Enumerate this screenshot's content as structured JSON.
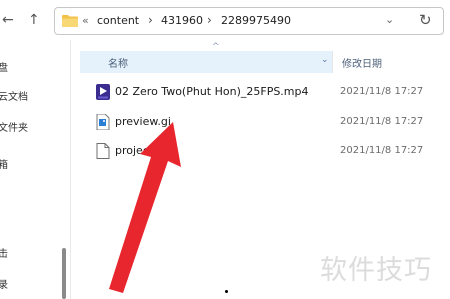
{
  "address_bar": {
    "overflow_label": "«",
    "crumbs": [
      "content",
      "431960",
      "2289975490"
    ],
    "separator": "›"
  },
  "nav": {
    "back": "←",
    "forward": "→",
    "up_chevron": "⌄",
    "refresh": "↻"
  },
  "left_pane": {
    "items": [
      "盘",
      "云文档",
      "文件夹",
      "箱",
      " ",
      " ",
      "击",
      " ",
      "录"
    ]
  },
  "columns": {
    "name": "名称",
    "date_modified": "修改日期",
    "sort_caret": "^",
    "chevron": "⌄"
  },
  "files": [
    {
      "name": "02 Zero Two(Phut Hon)_25FPS.mp4",
      "modified": "2021/11/8 17:27",
      "icon": "video-player-icon"
    },
    {
      "name": "preview.gi",
      "modified": "2021/11/8 17:27",
      "icon": "image-file-icon"
    },
    {
      "name": "project",
      "modified": "2021/11/8 17:27",
      "icon": "blank-file-icon"
    }
  ],
  "watermark": "软件技巧",
  "colors": {
    "arrow": "#e8262e",
    "header_bg": "#e5f1fb",
    "folder": "#f2c24a"
  }
}
